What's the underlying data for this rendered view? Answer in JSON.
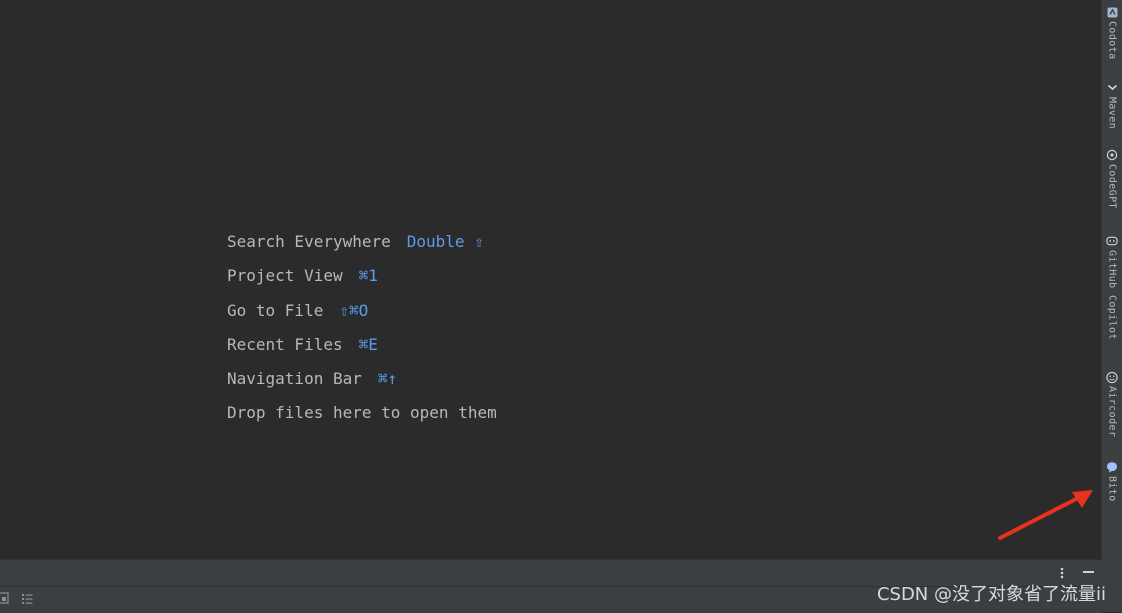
{
  "hints": [
    {
      "label": "Search Everywhere",
      "shortcut": "Double ⇧"
    },
    {
      "label": "Project View",
      "shortcut": "⌘1"
    },
    {
      "label": "Go to File",
      "shortcut": "⇧⌘O"
    },
    {
      "label": "Recent Files",
      "shortcut": "⌘E"
    },
    {
      "label": "Navigation Bar",
      "shortcut": "⌘↑"
    },
    {
      "label": "Drop files here to open them",
      "shortcut": ""
    }
  ],
  "tool_windows": [
    {
      "label": "Codota",
      "icon": "codota-icon"
    },
    {
      "label": "Maven",
      "icon": "maven-icon"
    },
    {
      "label": "CodeGPT",
      "icon": "codegpt-icon"
    },
    {
      "label": "GitHub Copilot",
      "icon": "github-copilot-icon"
    },
    {
      "label": "Aircoder",
      "icon": "aircoder-icon"
    },
    {
      "label": "Bito",
      "icon": "bito-icon"
    }
  ],
  "watermark": "CSDN @没了对象省了流量ii",
  "colors": {
    "editor_bg": "#2b2b2b",
    "panel_bg": "#3c3f41",
    "hint_text": "#b4b8bf",
    "shortcut_text": "#5a9bec",
    "arrow": "#e8321e"
  }
}
